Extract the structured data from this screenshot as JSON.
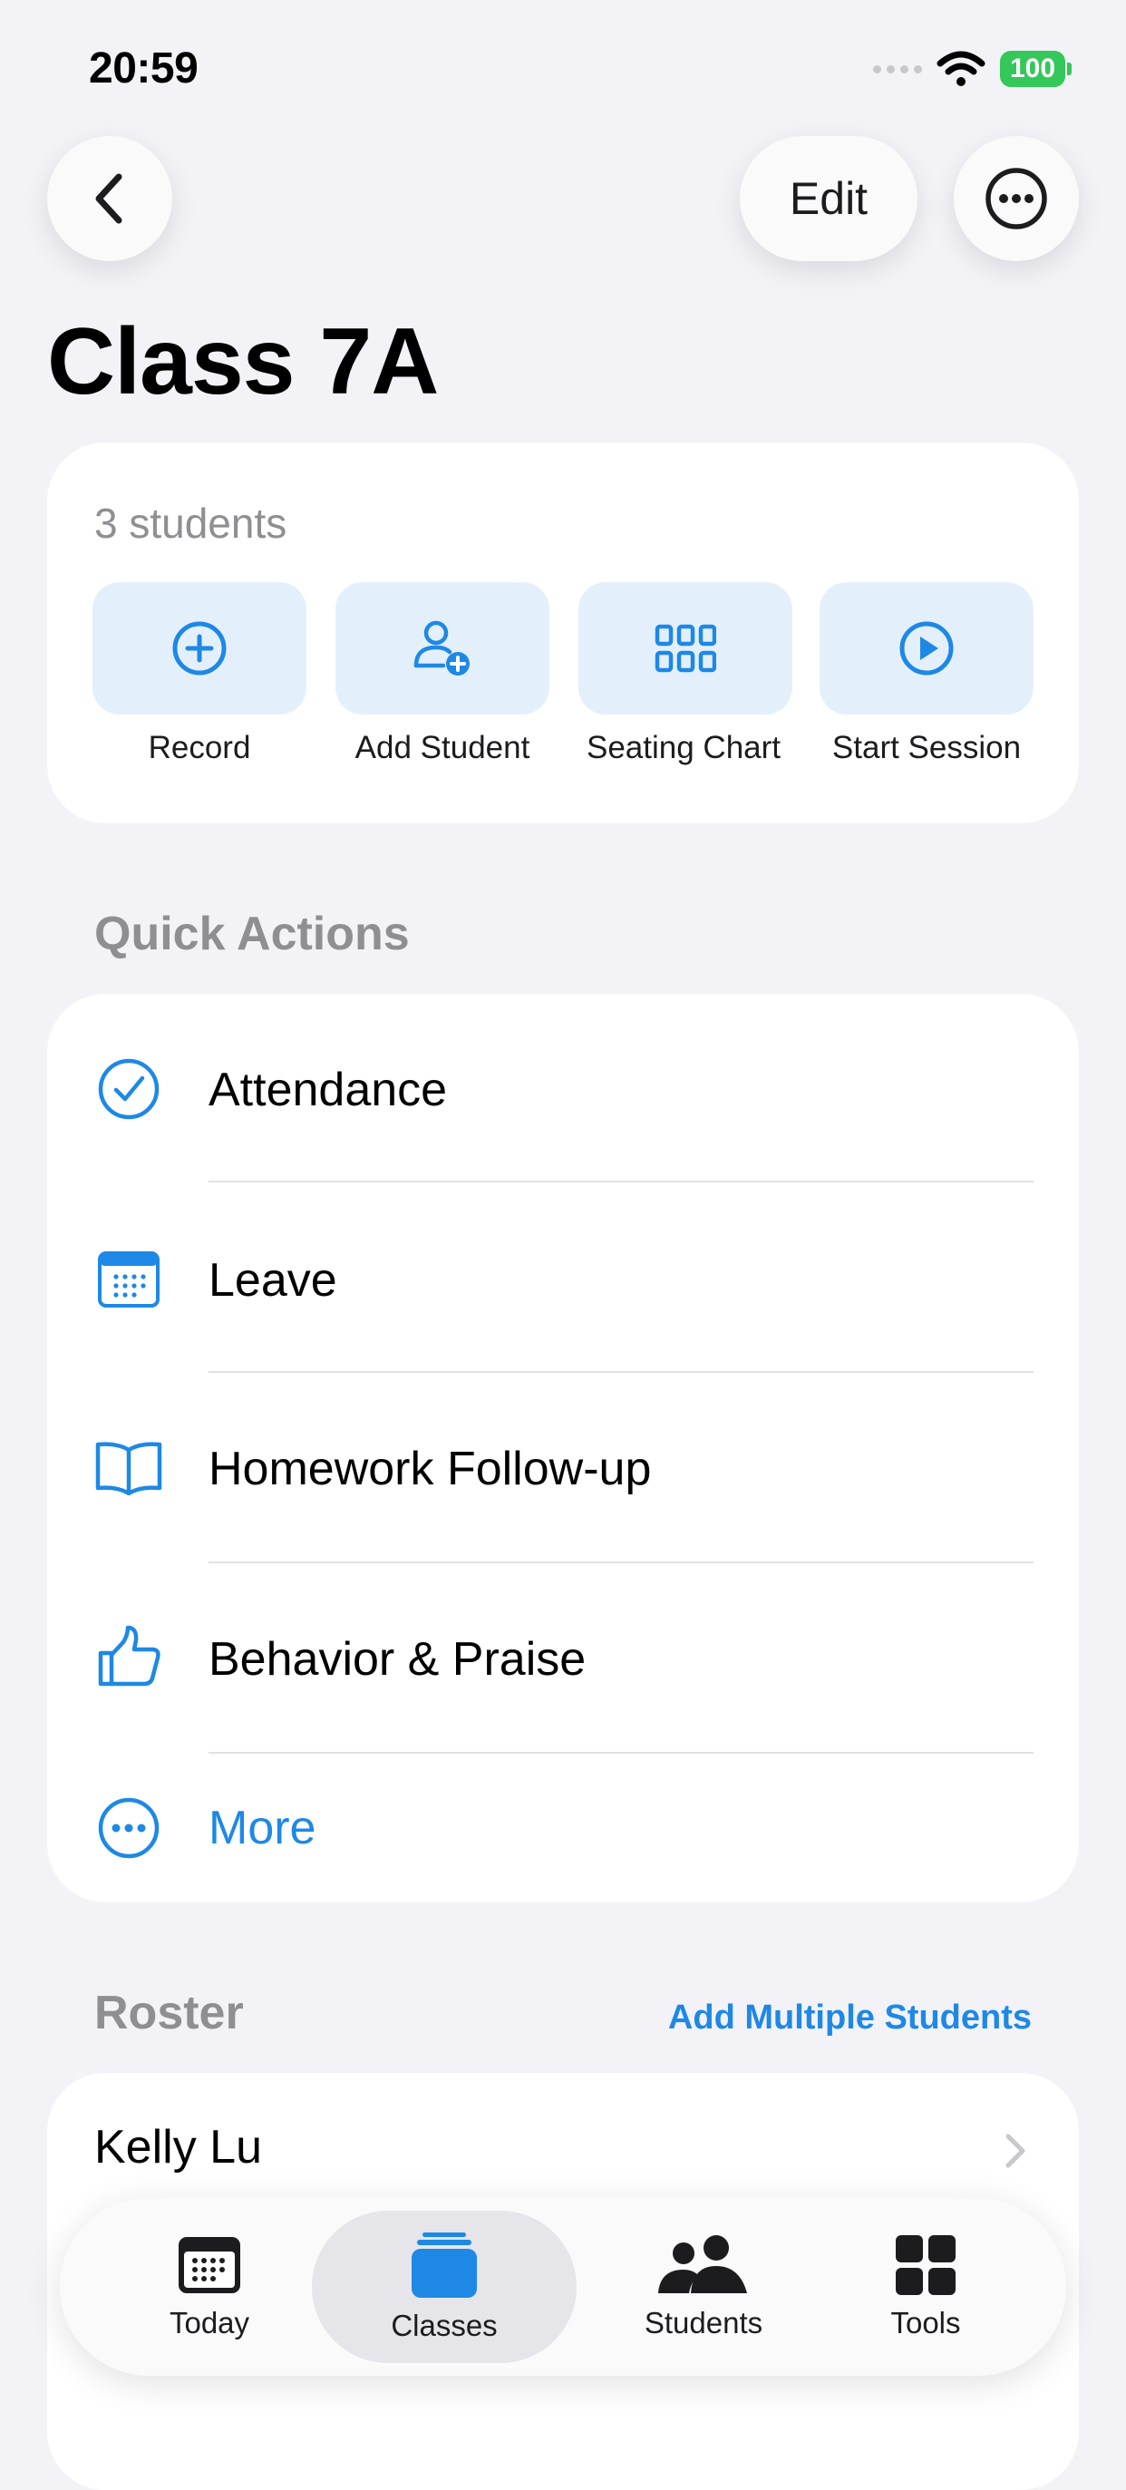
{
  "status": {
    "time": "20:59",
    "battery": "100"
  },
  "nav": {
    "edit_label": "Edit"
  },
  "page": {
    "title": "Class 7A"
  },
  "summary": {
    "count_text": "3 students",
    "actions": [
      {
        "label": "Record",
        "icon": "plus-circle-icon"
      },
      {
        "label": "Add Student",
        "icon": "person-add-icon"
      },
      {
        "label": "Seating Chart",
        "icon": "grid-icon"
      },
      {
        "label": "Start Session",
        "icon": "play-circle-icon"
      }
    ]
  },
  "quick_actions": {
    "header": "Quick Actions",
    "items": [
      {
        "label": "Attendance",
        "icon": "checkmark-circle-icon"
      },
      {
        "label": "Leave",
        "icon": "calendar-icon"
      },
      {
        "label": "Homework Follow-up",
        "icon": "book-icon"
      },
      {
        "label": "Behavior & Praise",
        "icon": "thumbs-up-icon"
      },
      {
        "label": "More",
        "icon": "ellipsis-circle-icon"
      }
    ]
  },
  "roster": {
    "header": "Roster",
    "add_multiple_label": "Add Multiple Students",
    "students": [
      {
        "name": "Kelly Lu"
      }
    ]
  },
  "tabbar": {
    "tabs": [
      {
        "label": "Today",
        "icon": "calendar-icon"
      },
      {
        "label": "Classes",
        "icon": "stack-icon",
        "active": true
      },
      {
        "label": "Students",
        "icon": "people-icon"
      },
      {
        "label": "Tools",
        "icon": "grid-icon"
      }
    ]
  },
  "colors": {
    "accent": "#1E88E5",
    "tile_bg": "#E3F0FC",
    "background": "#F2F2F7",
    "battery": "#34C759"
  }
}
